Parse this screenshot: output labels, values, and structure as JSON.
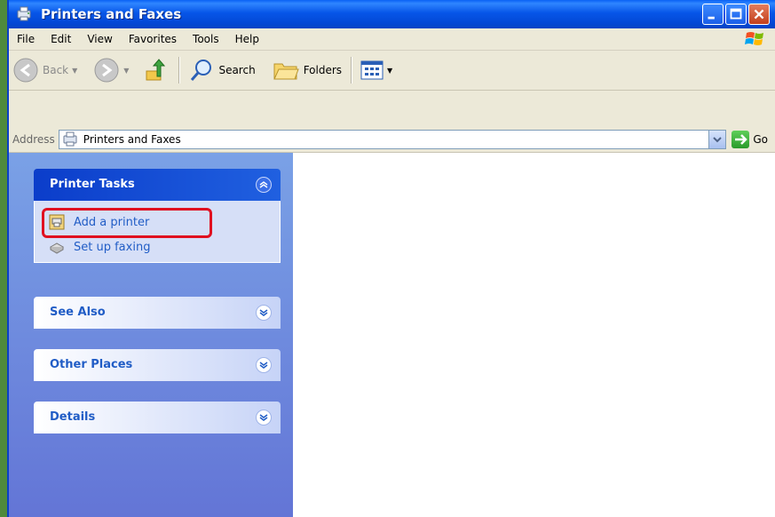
{
  "window": {
    "title": "Printers and Faxes",
    "controls": [
      "minimize",
      "maximize",
      "close"
    ]
  },
  "menu": {
    "items": [
      "File",
      "Edit",
      "View",
      "Favorites",
      "Tools",
      "Help"
    ]
  },
  "toolbar": {
    "back_label": "Back",
    "search_label": "Search",
    "folders_label": "Folders"
  },
  "address": {
    "label": "Address",
    "value": "Printers and Faxes",
    "go_label": "Go"
  },
  "taskpane": {
    "printer_tasks": {
      "title": "Printer Tasks",
      "items": [
        "Add a printer",
        "Set up faxing"
      ]
    },
    "see_also": {
      "title": "See Also"
    },
    "other_places": {
      "title": "Other Places"
    },
    "details": {
      "title": "Details"
    }
  },
  "colors": {
    "title_bar": "#0756e8",
    "task_link": "#215dc6",
    "highlight": "#e01020"
  }
}
